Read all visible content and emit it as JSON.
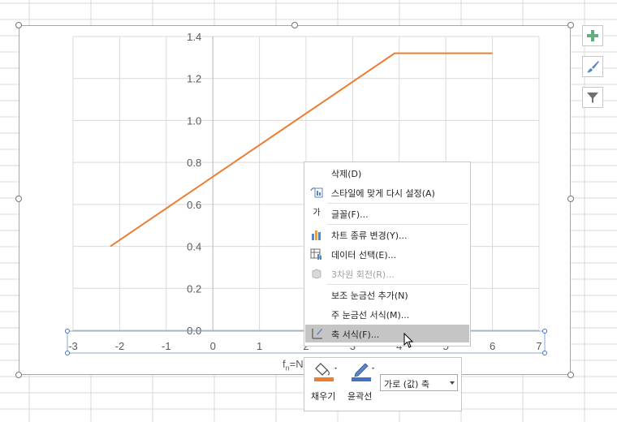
{
  "chart_data": {
    "type": "line",
    "x": [
      -2.2,
      3.9,
      6.0
    ],
    "series": [
      {
        "values": [
          0.4,
          1.32,
          1.32
        ],
        "color": "#ed7d31"
      }
    ],
    "xlim": [
      -3,
      7
    ],
    "ylim": [
      0.0,
      1.4
    ],
    "x_ticks": [
      "-3",
      "-2",
      "-1",
      "0",
      "1",
      "2",
      "3",
      "4",
      "5",
      "6",
      "7"
    ],
    "y_ticks": [
      "0.0",
      "0.2",
      "0.4",
      "0.6",
      "0.8",
      "1.0",
      "1.2",
      "1.4"
    ],
    "xlabel": "fn=N",
    "grid": true,
    "selected_element": "horizontal (value) axis"
  },
  "side_buttons": [
    {
      "icon": "plus-icon",
      "tooltip": ""
    },
    {
      "icon": "brush-icon",
      "tooltip": ""
    },
    {
      "icon": "filter-icon",
      "tooltip": ""
    }
  ],
  "context_menu": {
    "items": [
      {
        "label": "삭제(D)",
        "icon": "",
        "disabled": false
      },
      {
        "label": "스타일에 맞게 다시 설정(A)",
        "icon": "reset-style-icon",
        "disabled": false
      },
      {
        "label": "글꼴(F)...",
        "icon": "font-icon",
        "icon_text": "가",
        "disabled": false
      },
      {
        "label": "차트 종류 변경(Y)...",
        "icon": "chart-type-icon",
        "disabled": false
      },
      {
        "label": "데이터 선택(E)...",
        "icon": "select-data-icon",
        "disabled": false
      },
      {
        "label": "3차원 회전(R)...",
        "icon": "rotate-3d-icon",
        "disabled": true
      },
      {
        "label": "보조 눈금선 추가(N)",
        "icon": "",
        "disabled": false
      },
      {
        "label": "주 눈금선 서식(M)...",
        "icon": "",
        "disabled": false
      },
      {
        "label": "축 서식(F)...",
        "icon": "format-axis-icon",
        "disabled": false,
        "highlighted": true
      }
    ]
  },
  "mini_toolbar": {
    "fill_label": "채우기",
    "outline_label": "윤곽선",
    "fill_color": "#ed7d31",
    "outline_color": "#4472c4",
    "element_select": "가로 (값) 축"
  }
}
